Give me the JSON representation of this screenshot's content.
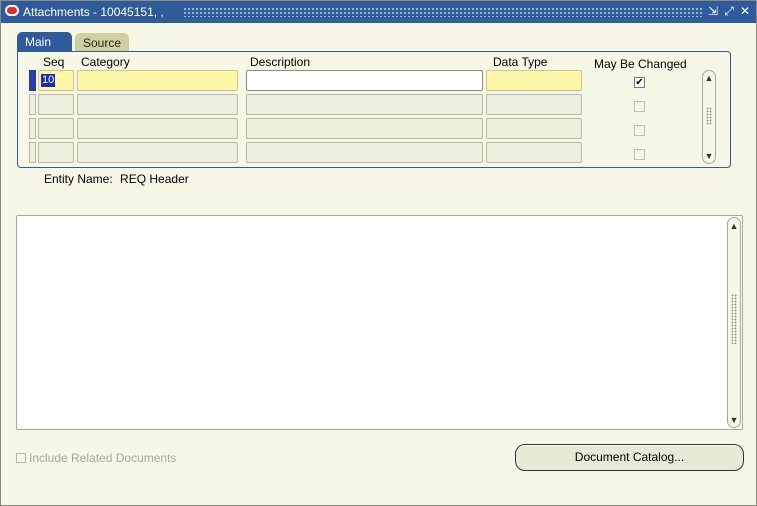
{
  "window": {
    "title": "Attachments - 10045151, ,",
    "controls": {
      "minimize": "⇲",
      "maximize": "⤢",
      "close": "✕"
    }
  },
  "tabs": [
    {
      "label": "Main",
      "active": true
    },
    {
      "label": "Source",
      "active": false
    }
  ],
  "grid": {
    "headers": {
      "seq": "Seq",
      "category": "Category",
      "description": "Description",
      "data_type": "Data Type",
      "may_be_changed": "May Be Changed"
    },
    "rows": [
      {
        "seq": "10",
        "category": "",
        "description": "",
        "data_type": "",
        "may_be_changed": true,
        "active": true
      },
      {
        "seq": "",
        "category": "",
        "description": "",
        "data_type": "",
        "may_be_changed": false,
        "active": false
      },
      {
        "seq": "",
        "category": "",
        "description": "",
        "data_type": "",
        "may_be_changed": false,
        "active": false
      },
      {
        "seq": "",
        "category": "",
        "description": "",
        "data_type": "",
        "may_be_changed": false,
        "active": false
      }
    ]
  },
  "entity": {
    "label": "Entity Name:",
    "value": "REQ Header"
  },
  "include_related": {
    "label": "Include Related Documents",
    "checked": false,
    "enabled": false
  },
  "buttons": {
    "document_catalog": "Document Catalog..."
  },
  "icons": {
    "check": "✔",
    "scroll_up": "▲",
    "scroll_down": "▼"
  },
  "colors": {
    "titlebar": "#2f5b9b",
    "background": "#f7f7e7",
    "required_field": "#fff7a8",
    "selection": "#1a2db0"
  }
}
